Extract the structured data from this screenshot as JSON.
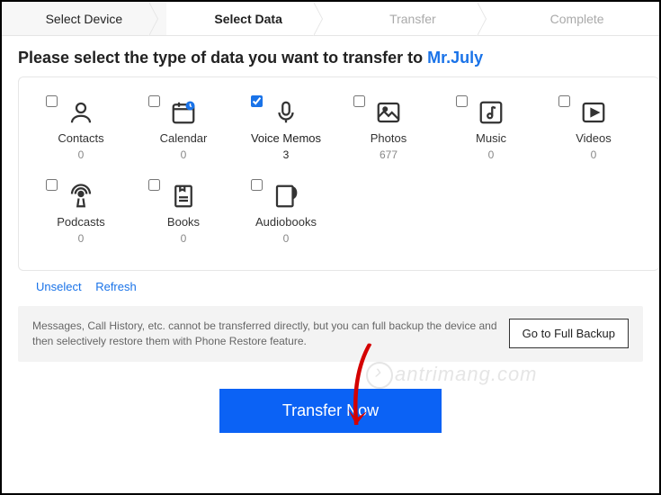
{
  "steps": {
    "s1": "Select Device",
    "s2": "Select Data",
    "s3": "Transfer",
    "s4": "Complete"
  },
  "instruction": {
    "prefix": "Please select the type of data you want to transfer to ",
    "target": "Mr.July"
  },
  "items": [
    {
      "label": "Contacts",
      "count": "0",
      "checked": false,
      "icon": "contacts"
    },
    {
      "label": "Calendar",
      "count": "0",
      "checked": false,
      "icon": "calendar"
    },
    {
      "label": "Voice Memos",
      "count": "3",
      "checked": true,
      "icon": "mic"
    },
    {
      "label": "Photos",
      "count": "677",
      "checked": false,
      "icon": "photos"
    },
    {
      "label": "Music",
      "count": "0",
      "checked": false,
      "icon": "music"
    },
    {
      "label": "Videos",
      "count": "0",
      "checked": false,
      "icon": "videos"
    },
    {
      "label": "Podcasts",
      "count": "0",
      "checked": false,
      "icon": "podcasts"
    },
    {
      "label": "Books",
      "count": "0",
      "checked": false,
      "icon": "books"
    },
    {
      "label": "Audiobooks",
      "count": "0",
      "checked": false,
      "icon": "audiobooks"
    }
  ],
  "links": {
    "unselect": "Unselect",
    "refresh": "Refresh"
  },
  "note": {
    "text": "Messages, Call History, etc. cannot be transferred directly, but you can full backup the device and then selectively restore them with Phone Restore feature.",
    "button": "Go to Full Backup"
  },
  "primary": "Transfer Now",
  "watermark": "antrimang.com"
}
